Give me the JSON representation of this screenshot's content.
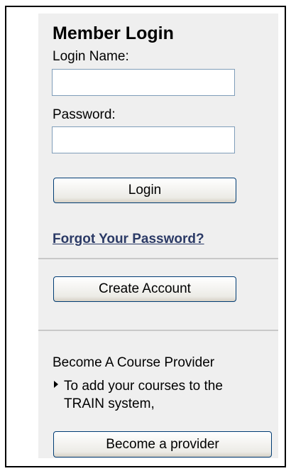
{
  "login": {
    "title": "Member Login",
    "login_name_label": "Login Name:",
    "login_name_value": "",
    "password_label": "Password:",
    "password_value": "",
    "login_button": "Login",
    "forgot_password_link": "Forgot Your Password?"
  },
  "account": {
    "create_account_button": "Create Account"
  },
  "provider": {
    "heading": "Become A Course Provider",
    "bullet_text": "To add your courses to the TRAIN system,",
    "become_provider_button": "Become a provider"
  }
}
